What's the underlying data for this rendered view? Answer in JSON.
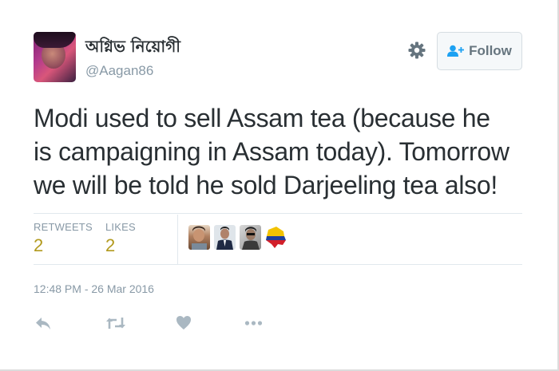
{
  "tweet": {
    "author": {
      "display_name": "অগ্নিভ নিয়োগী",
      "handle": "@Aagan86"
    },
    "follow_label": "Follow",
    "text": "Modi used to sell Assam tea (because he is campaigning in Assam today). Tomorrow we will be told he sold Darjeeling tea also!",
    "stats": {
      "retweets_label": "RETWEETS",
      "retweets_value": "2",
      "likes_label": "LIKES",
      "likes_value": "2"
    },
    "timestamp": "12:48 PM - 26 Mar 2016"
  },
  "icons": {
    "settings": "gear-icon",
    "follow": "add-user-icon",
    "reply": "reply-icon",
    "retweet": "retweet-icon",
    "like": "heart-icon",
    "more": "more-dots-icon"
  },
  "colors": {
    "text": "#292f33",
    "muted": "#8899a6",
    "stat_value": "#b29a1e",
    "icon": "#aab8c2",
    "divider": "#e1e8ed"
  }
}
